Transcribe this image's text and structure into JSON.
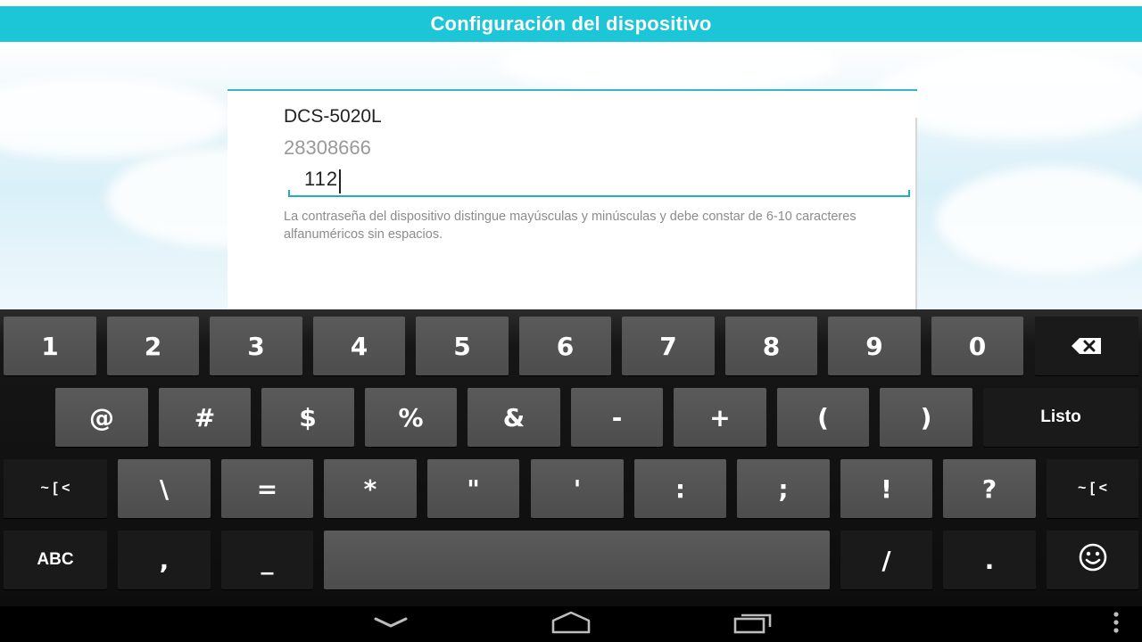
{
  "app": {
    "title": "Configuración del dispositivo"
  },
  "form": {
    "device_name": "DCS-5020L",
    "device_id": "28308666",
    "password_value": "112",
    "help_text": "La contraseña del dispositivo distingue mayúsculas y minúsculas y debe constar de 6-10 caracteres alfanuméricos sin espacios."
  },
  "keyboard": {
    "row1": [
      "1",
      "2",
      "3",
      "4",
      "5",
      "6",
      "7",
      "8",
      "9",
      "0"
    ],
    "row2": [
      "@",
      "#",
      "$",
      "%",
      "&",
      "-",
      "+",
      "(",
      ")"
    ],
    "row3": [
      "\\",
      "=",
      "*",
      "\"",
      "'",
      ":",
      ";",
      "!",
      "?"
    ],
    "listo_label": "Listo",
    "more_symbols_label": "~ [ <",
    "abc_label": "ABC",
    "comma_label": ",",
    "underscore_label": "_",
    "slash_label": "/",
    "period_label": ".",
    "icons": {
      "backspace": "backspace-icon",
      "emoji": "emoji-icon"
    }
  },
  "nav": {
    "icons": [
      "back-icon",
      "home-icon",
      "recent-apps-icon",
      "overflow-menu-icon"
    ]
  },
  "colors": {
    "title_bar": "#1dc6d6",
    "accent": "#22aebf",
    "key": "#4d4d4d",
    "keyboard_bg": "#0d0d0d"
  }
}
